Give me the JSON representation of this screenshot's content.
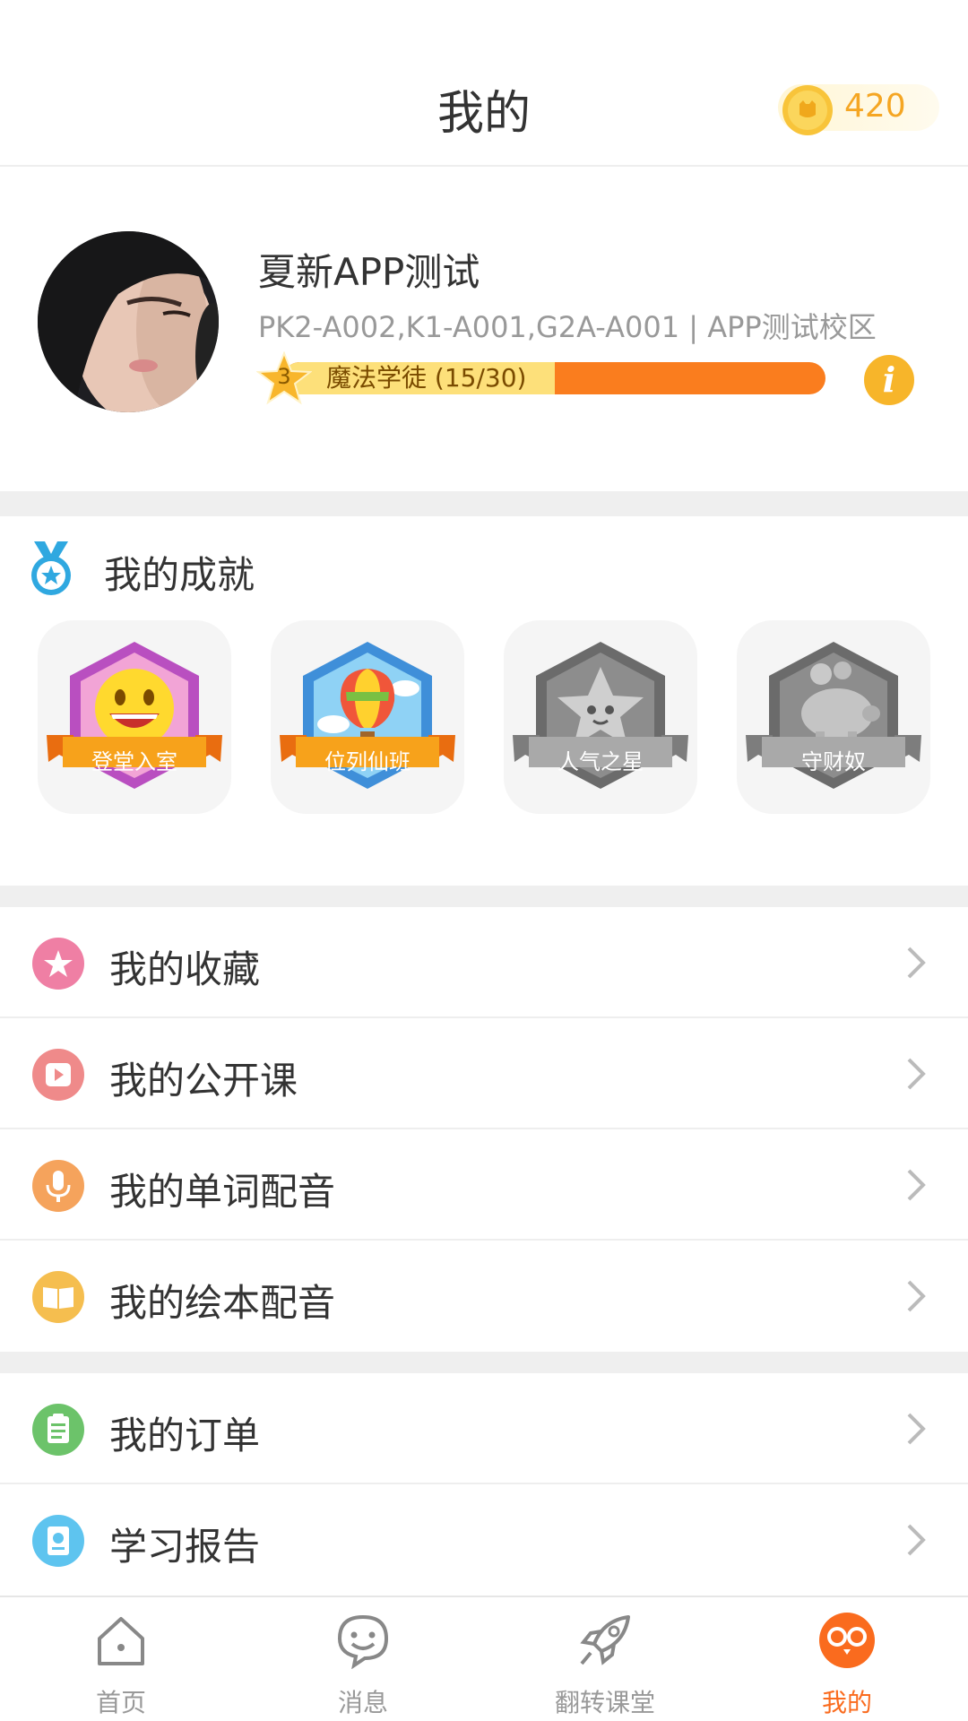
{
  "header": {
    "title": "我的",
    "coin_count": "420",
    "coin_icon": "gold-coin-icon"
  },
  "profile": {
    "name": "夏新APP测试",
    "classes": "PK2-A002,K1-A001,G2A-A001 | APP测试校区",
    "level": "3",
    "level_title": "魔法学徒 (15/30)",
    "level_progress": 0.5,
    "info_icon": "info-icon"
  },
  "achievements": {
    "title": "我的成就",
    "badges": [
      {
        "label": "登堂入室",
        "earned": true,
        "icon": "smiley-badge-icon"
      },
      {
        "label": "位列仙班",
        "earned": true,
        "icon": "hot-air-balloon-badge-icon"
      },
      {
        "label": "人气之星",
        "earned": false,
        "icon": "star-badge-icon"
      },
      {
        "label": "守财奴",
        "earned": false,
        "icon": "piggy-bank-badge-icon"
      }
    ]
  },
  "menu": [
    {
      "label": "我的收藏",
      "icon": "star-icon",
      "color": "#ef7fa4"
    },
    {
      "label": "我的公开课",
      "icon": "play-icon",
      "color": "#ef8a8a"
    },
    {
      "label": "我的单词配音",
      "icon": "microphone-icon",
      "color": "#f5a35c"
    },
    {
      "label": "我的绘本配音",
      "icon": "book-icon",
      "color": "#f5be4f"
    },
    {
      "label": "我的订单",
      "icon": "clipboard-icon",
      "color": "#6cc36a"
    },
    {
      "label": "学习报告",
      "icon": "report-icon",
      "color": "#5ec4ef"
    }
  ],
  "tabs": [
    {
      "label": "首页",
      "icon": "home-icon",
      "active": false
    },
    {
      "label": "消息",
      "icon": "message-icon",
      "active": false
    },
    {
      "label": "翻转课堂",
      "icon": "rocket-icon",
      "active": false
    },
    {
      "label": "我的",
      "icon": "owl-icon",
      "active": true
    }
  ],
  "colors": {
    "accent": "#fa6b1e",
    "level_bar": "#fa7d1e",
    "level_fill": "#fde07a",
    "coin": "#f5a623",
    "divider": "#efefef"
  }
}
